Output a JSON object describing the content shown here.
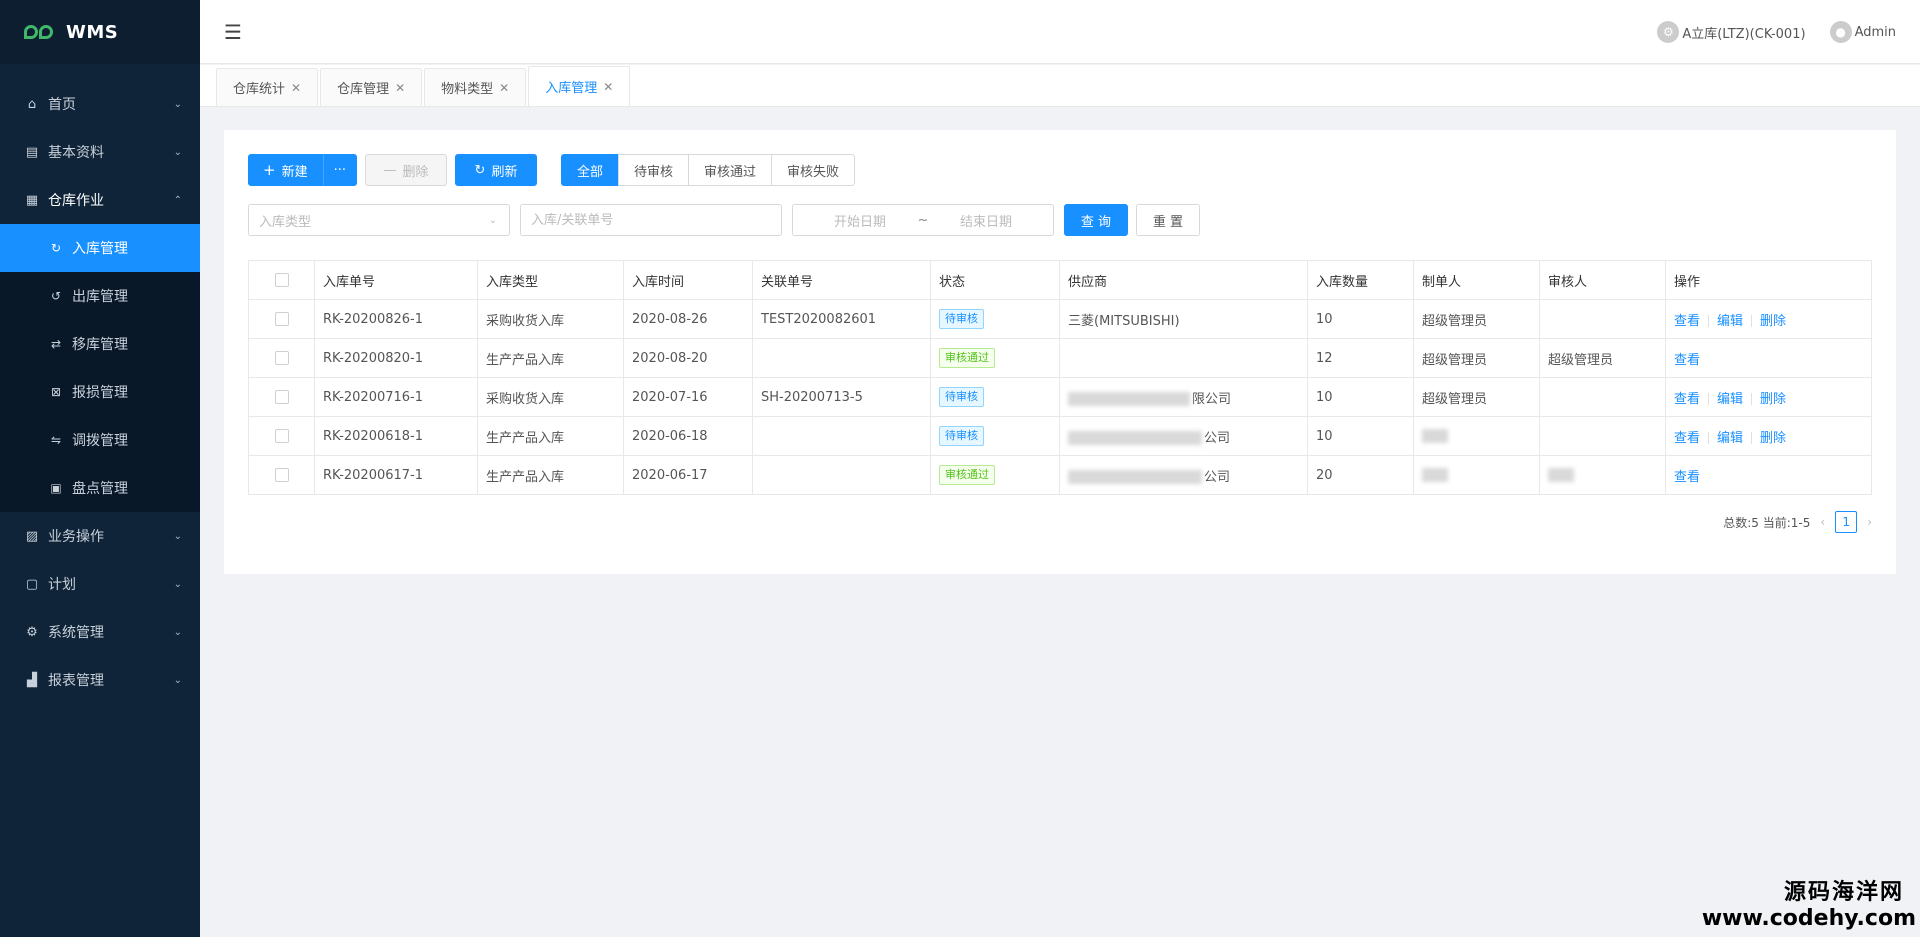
{
  "app": {
    "logo_text": "WMS"
  },
  "sidebar": {
    "items": [
      {
        "label": "首页",
        "icon": "home-icon",
        "glyph": "⌂",
        "chev": "⌄"
      },
      {
        "label": "基本资料",
        "icon": "card-icon",
        "glyph": "▤",
        "chev": "⌄"
      },
      {
        "label": "仓库作业",
        "icon": "grid-icon",
        "glyph": "▦",
        "chev": "⌃"
      },
      {
        "label": "业务操作",
        "icon": "document-icon",
        "glyph": "▨",
        "chev": "⌄"
      },
      {
        "label": "计划",
        "icon": "file-icon",
        "glyph": "▢",
        "chev": "⌄"
      },
      {
        "label": "系统管理",
        "icon": "gear-icon",
        "glyph": "⚙",
        "chev": "⌄"
      },
      {
        "label": "报表管理",
        "icon": "chart-icon",
        "glyph": "▟",
        "chev": "⌄"
      }
    ],
    "sub_items": [
      {
        "label": "入库管理",
        "icon": "inbound-icon",
        "glyph": "↻"
      },
      {
        "label": "出库管理",
        "icon": "outbound-icon",
        "glyph": "↺"
      },
      {
        "label": "移库管理",
        "icon": "transfer-icon",
        "glyph": "⇄"
      },
      {
        "label": "报损管理",
        "icon": "damage-icon",
        "glyph": "⊠"
      },
      {
        "label": "调拨管理",
        "icon": "allocate-icon",
        "glyph": "⇋"
      },
      {
        "label": "盘点管理",
        "icon": "inventory-icon",
        "glyph": "▣"
      }
    ]
  },
  "header": {
    "collapse_glyph": "☰",
    "warehouse": "A立库(LTZ)(CK-001)",
    "user": "Admin"
  },
  "tabs": [
    {
      "label": "仓库统计"
    },
    {
      "label": "仓库管理"
    },
    {
      "label": "物料类型"
    },
    {
      "label": "入库管理"
    }
  ],
  "toolbar": {
    "new_label": "新建",
    "more_label": "···",
    "delete_label": "删除",
    "refresh_label": "刷新",
    "filter_all": "全部",
    "filter_pending": "待审核",
    "filter_passed": "审核通过",
    "filter_failed": "审核失败"
  },
  "filters": {
    "type_placeholder": "入库类型",
    "order_placeholder": "入库/关联单号",
    "start_date": "开始日期",
    "range_sep": "~",
    "end_date": "结束日期",
    "query_label": "查 询",
    "reset_label": "重 置"
  },
  "table": {
    "columns": [
      "入库单号",
      "入库类型",
      "入库时间",
      "关联单号",
      "状态",
      "供应商",
      "入库数量",
      "制单人",
      "审核人",
      "操作"
    ],
    "rows": [
      {
        "no": "RK-20200826-1",
        "type": "采购收货入库",
        "time": "2020-08-26",
        "ref": "TEST2020082601",
        "status": "待审核",
        "status_kind": "pending",
        "supplier": "三菱(MITSUBISHI)",
        "qty": "10",
        "maker": "超级管理员",
        "auditor": "",
        "ops": [
          "查看",
          "编辑",
          "删除"
        ]
      },
      {
        "no": "RK-20200820-1",
        "type": "生产产品入库",
        "time": "2020-08-20",
        "ref": "",
        "status": "审核通过",
        "status_kind": "passed",
        "supplier": "",
        "qty": "12",
        "maker": "超级管理员",
        "auditor": "超级管理员",
        "ops": [
          "查看"
        ]
      },
      {
        "no": "RK-20200716-1",
        "type": "采购收货入库",
        "time": "2020-07-16",
        "ref": "SH-20200713-5",
        "status": "待审核",
        "status_kind": "pending",
        "supplier": "限公司",
        "qty": "10",
        "maker": "超级管理员",
        "auditor": "",
        "ops": [
          "查看",
          "编辑",
          "删除"
        ]
      },
      {
        "no": "RK-20200618-1",
        "type": "生产产品入库",
        "time": "2020-06-18",
        "ref": "",
        "status": "待审核",
        "status_kind": "pending",
        "supplier": "公司",
        "qty": "10",
        "maker": "",
        "auditor": "",
        "ops": [
          "查看",
          "编辑",
          "删除"
        ]
      },
      {
        "no": "RK-20200617-1",
        "type": "生产产品入库",
        "time": "2020-06-17",
        "ref": "",
        "status": "审核通过",
        "status_kind": "passed",
        "supplier": "公司",
        "qty": "20",
        "maker": "",
        "auditor": "",
        "ops": [
          "查看"
        ]
      }
    ]
  },
  "pager": {
    "summary": "总数:5 当前:1-5",
    "prev": "‹",
    "current": "1",
    "next": "›"
  },
  "watermark": {
    "line1": "源码海洋网",
    "line2": "www.codehy.com"
  },
  "colors": {
    "primary": "#1890ff",
    "sidebar_bg": "#0f2438",
    "logo_green": "#3fb86a"
  }
}
